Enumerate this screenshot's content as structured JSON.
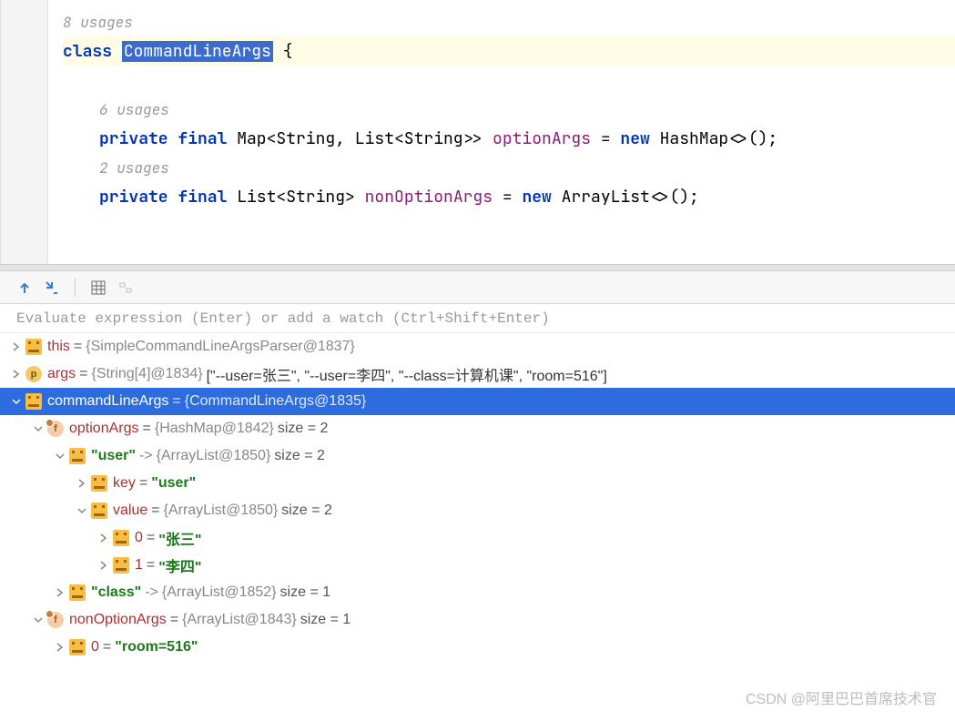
{
  "editor": {
    "usages_top": "8 usages",
    "class_kw": "class",
    "class_name": "CommandLineArgs",
    "brace_open": "{",
    "usages_a": "6 usages",
    "line_a_pre": "private final ",
    "line_a_type": "Map<String, List<String>>",
    "line_a_field": "optionArgs",
    "line_a_eq": " = ",
    "line_a_new": "new ",
    "line_a_ctor": "HashMap<>();",
    "usages_b": "2 usages",
    "line_b_pre": "private final ",
    "line_b_type": "List<String>",
    "line_b_field": "nonOptionArgs",
    "line_b_eq": " = ",
    "line_b_new": "new ",
    "line_b_ctor": "ArrayList<>();"
  },
  "toolbar": {
    "eval_placeholder": "Evaluate expression (Enter) or add a watch (Ctrl+Shift+Enter)"
  },
  "icons": {
    "p_glyph": "p",
    "f_glyph": "f"
  },
  "vars": {
    "this_name": "this",
    "this_val": "{SimpleCommandLineArgsParser@1837}",
    "args_name": "args",
    "args_val": "{String[4]@1834}",
    "args_arr": "[\"--user=张三\", \"--user=李四\", \"--class=计算机课\", \"room=516\"]",
    "cla_name": "commandLineArgs",
    "cla_val": "{CommandLineArgs@1835}",
    "option_name": "optionArgs",
    "option_val": "{HashMap@1842}",
    "option_size": "size = 2",
    "user_key": "\"user\"",
    "user_val": "{ArrayList@1850}",
    "user_size": "size = 2",
    "key_name": "key",
    "key_val": "\"user\"",
    "value_name": "value",
    "value_val": "{ArrayList@1850}",
    "value_size": "size = 2",
    "idx0": "0",
    "idx0_val": "\"张三\"",
    "idx1": "1",
    "idx1_val": "\"李四\"",
    "class_key": "\"class\"",
    "class_val": "{ArrayList@1852}",
    "class_size": "size = 1",
    "nonopt_name": "nonOptionArgs",
    "nonopt_val": "{ArrayList@1843}",
    "nonopt_size": "size = 1",
    "nonopt_idx0": "0",
    "nonopt_idx0_val": "\"room=516\""
  },
  "watermark": "CSDN @阿里巴巴首席技术官"
}
